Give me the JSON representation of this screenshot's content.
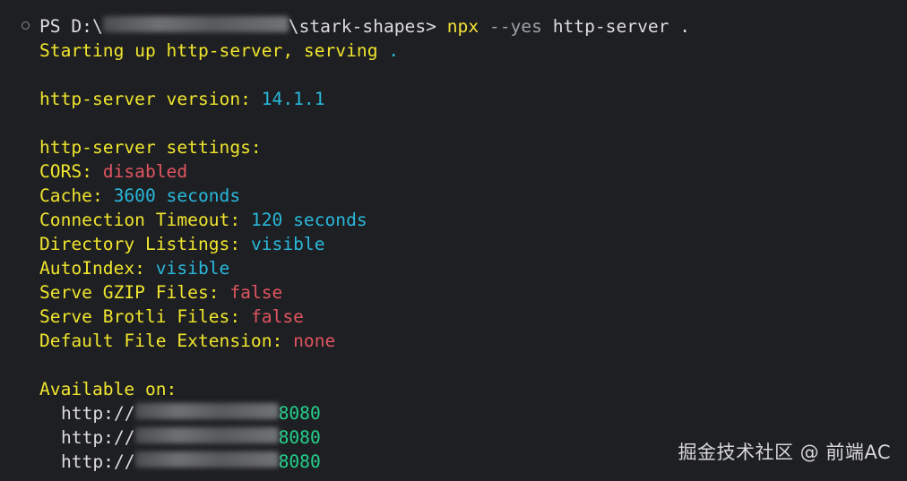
{
  "terminal": {
    "prompt": {
      "prefix": "PS D:\\",
      "path_suffix": "\\stark-shapes> ",
      "cmd_npx": "npx",
      "cmd_flag": "--yes",
      "cmd_rest": "http-server ."
    },
    "starting": {
      "text": "Starting up http-server, serving ",
      "dot": "."
    },
    "version": {
      "label": "http-server version: ",
      "value": "14.1.1"
    },
    "settings_header": "http-server settings:",
    "settings": [
      {
        "label": "CORS: ",
        "value": "disabled",
        "tone": "red"
      },
      {
        "label": "Cache: ",
        "value": "3600 seconds",
        "tone": "cyan"
      },
      {
        "label": "Connection Timeout: ",
        "value": "120 seconds",
        "tone": "cyan"
      },
      {
        "label": "Directory Listings: ",
        "value": "visible",
        "tone": "cyan"
      },
      {
        "label": "AutoIndex: ",
        "value": "visible",
        "tone": "cyan"
      },
      {
        "label": "Serve GZIP Files: ",
        "value": "false",
        "tone": "red"
      },
      {
        "label": "Serve Brotli Files: ",
        "value": "false",
        "tone": "red"
      },
      {
        "label": "Default File Extension: ",
        "value": "none",
        "tone": "red"
      }
    ],
    "available_header": "Available on:",
    "addresses": [
      {
        "scheme": "http://",
        "port": "8080"
      },
      {
        "scheme": "http://",
        "port": "8080"
      },
      {
        "scheme": "http://",
        "port": "8080"
      }
    ]
  },
  "watermark": "掘金技术社区 @ 前端AC",
  "colors": {
    "background": "#1e1f22",
    "yellow": "#f0e52e",
    "cyan": "#29b8db",
    "red": "#e05561",
    "green": "#23d18b"
  }
}
